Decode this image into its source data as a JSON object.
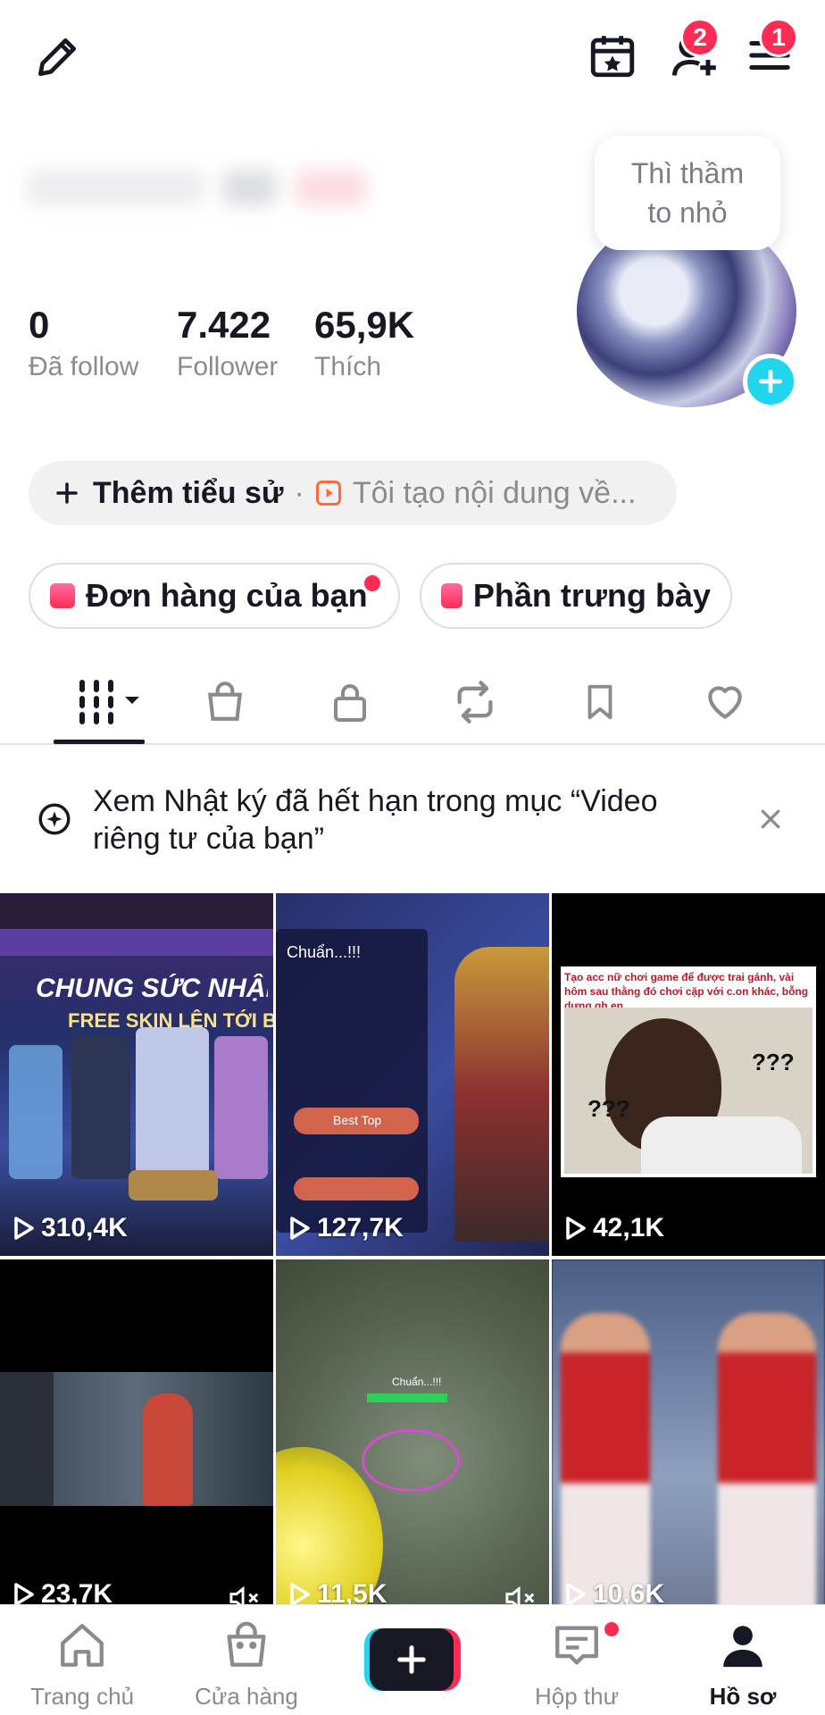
{
  "header": {
    "edit_icon": "pencil-icon",
    "calendar_icon": "calendar-star-icon",
    "add_friends_icon": "add-user-icon",
    "add_friends_badge": "2",
    "menu_icon": "menu-icon",
    "menu_badge": "1"
  },
  "profile": {
    "note_bubble_line1": "Thì thầm",
    "note_bubble_line2": "to nhỏ"
  },
  "stats": [
    {
      "value": "0",
      "label": "Đã follow"
    },
    {
      "value": "7.422",
      "label": "Follower"
    },
    {
      "value": "65,9K",
      "label": "Thích"
    }
  ],
  "bio": {
    "add_label": "Thêm tiểu sử",
    "separator": "·",
    "hint": "Tôi tạo nội dung về..."
  },
  "chips": [
    {
      "label": "Đơn hàng của bạn"
    },
    {
      "label": "Phần trưng bày"
    }
  ],
  "tabs": [
    {
      "icon": "grid-icon"
    },
    {
      "icon": "shopping-bag-icon"
    },
    {
      "icon": "lock-icon"
    },
    {
      "icon": "repost-icon"
    },
    {
      "icon": "bookmark-icon"
    },
    {
      "icon": "heart-icon"
    }
  ],
  "notice": {
    "text": "Xem Nhật ký đã hết hạn trong mục “Video riêng tư của bạn”"
  },
  "videos": [
    {
      "views": "310,4K",
      "caption_1": "CHUNG SỨC NHẬN Q",
      "caption_2": "FREE SKIN LÊN TỚI BẬC S"
    },
    {
      "views": "127,7K",
      "caption_1": "Chuẩn...!!!",
      "caption_2": "Best Top"
    },
    {
      "views": "42,1K",
      "caption_1": "Tạo acc nữ chơi game để được trai gánh, vài hôm sau thằng đó chơi cặp với c.on khác, bỗng dưng gh.en",
      "caption_2": "???"
    },
    {
      "views": "23,7K"
    },
    {
      "views": "11,5K",
      "caption_1": "Chuẩn...!!!"
    },
    {
      "views": "10,6K"
    }
  ],
  "nav": [
    {
      "label": "Trang chủ",
      "icon": "home-icon"
    },
    {
      "label": "Cửa hàng",
      "icon": "shop-icon"
    },
    {
      "label": "",
      "icon": "plus-icon"
    },
    {
      "label": "Hộp thư",
      "icon": "inbox-icon"
    },
    {
      "label": "Hồ sơ",
      "icon": "profile-icon"
    }
  ],
  "colors": {
    "accent": "#fe2c55",
    "cyan": "#20d5ec",
    "text": "#161823",
    "muted": "#8a8b91"
  }
}
